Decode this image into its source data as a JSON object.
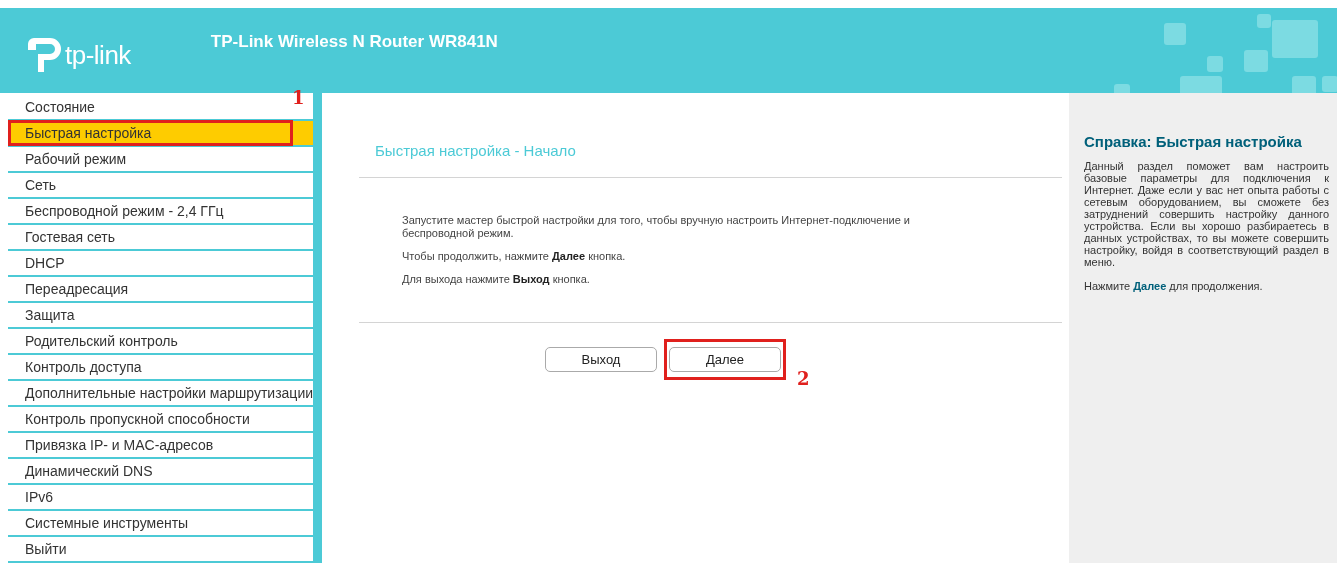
{
  "header": {
    "logo_text": "tp-link",
    "title": "TP-Link Wireless N Router WR841N"
  },
  "sidebar": {
    "items": [
      {
        "label": "Состояние",
        "selected": false
      },
      {
        "label": "Быстрая настройка",
        "selected": true,
        "callout": "1"
      },
      {
        "label": "Рабочий режим",
        "selected": false
      },
      {
        "label": "Сеть",
        "selected": false
      },
      {
        "label": "Беспроводной режим - 2,4 ГГц",
        "selected": false
      },
      {
        "label": "Гостевая сеть",
        "selected": false
      },
      {
        "label": "DHCP",
        "selected": false
      },
      {
        "label": "Переадресация",
        "selected": false
      },
      {
        "label": "Защита",
        "selected": false
      },
      {
        "label": "Родительский контроль",
        "selected": false
      },
      {
        "label": "Контроль доступа",
        "selected": false
      },
      {
        "label": "Дополнительные настройки маршрутизации",
        "selected": false
      },
      {
        "label": "Контроль пропускной способности",
        "selected": false
      },
      {
        "label": "Привязка IP- и MAC-адресов",
        "selected": false
      },
      {
        "label": "Динамический DNS",
        "selected": false
      },
      {
        "label": "IPv6",
        "selected": false
      },
      {
        "label": "Системные инструменты",
        "selected": false
      },
      {
        "label": "Выйти",
        "selected": false
      }
    ]
  },
  "main": {
    "title": "Быстрая настройка - Начало",
    "paragraphs": [
      "Запустите мастер быстрой настройки для того, чтобы вручную настроить Интернет-подключение и беспроводной режим.",
      "Чтобы продолжить, нажмите **Далее** кнопка.",
      "Для выхода нажмите **Выход** кнопка."
    ],
    "buttons": [
      {
        "label": "Выход"
      },
      {
        "label": "Далее",
        "callout": "2"
      }
    ]
  },
  "help": {
    "title": "Справка: Быстрая настройка",
    "paragraphs": [
      "Данный раздел поможет вам настроить базовые параметры для подключения к Интернет. Даже если у вас нет опыта работы с сетевым оборудованием, вы сможете без затруднений совершить настройку данного устройства. Если вы хорошо разбираетесь в данных устройствах, то вы можете совершить настройку, войдя в соответствующий раздел в меню.",
      "Нажмите **Далее** для продолжения."
    ]
  }
}
